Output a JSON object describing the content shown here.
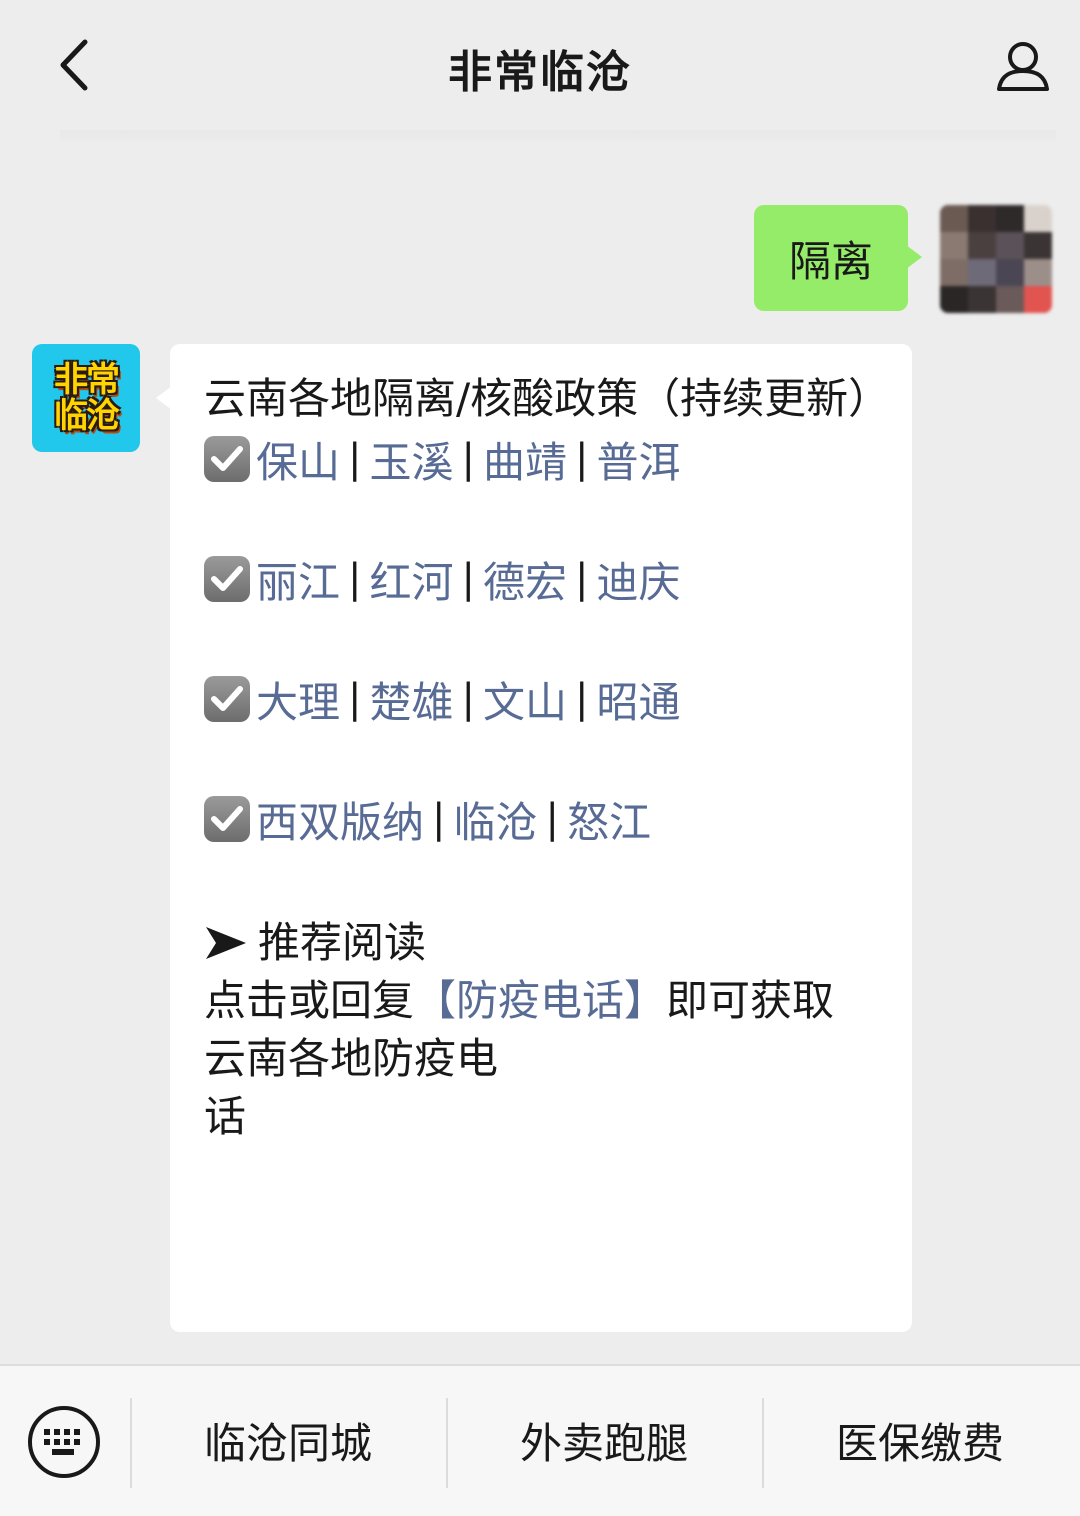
{
  "header": {
    "title": "非常临沧"
  },
  "outgoing": {
    "text": "隔离"
  },
  "bot": {
    "avatar_line1": "非常",
    "avatar_line2": "临沧"
  },
  "message": {
    "title": "云南各地隔离/核酸政策（持续更新）",
    "rows": [
      [
        "保山",
        "玉溪",
        "曲靖",
        "普洱"
      ],
      [
        "丽江",
        "红河",
        "德宏",
        "迪庆"
      ],
      [
        "大理",
        "楚雄",
        "文山",
        "昭通"
      ],
      [
        "西双版纳",
        "临沧",
        "怒江"
      ]
    ],
    "separator": "|",
    "recommend_label": "推荐阅读",
    "tip_prefix": "点击或回复",
    "tip_link": "【防疫电话】",
    "tip_suffix": "即可获取",
    "tip_line2": "云南各地防疫电",
    "tip_line3": "话"
  },
  "bottom_menu": {
    "items": [
      "临沧同城",
      "外卖跑腿",
      "医保缴费"
    ]
  },
  "colors": {
    "background": "#ededed",
    "outgoing_bubble": "#95ec69",
    "link": "#576b95",
    "bot_avatar": "#22c7ec"
  },
  "icons": {
    "back": "chevron-left-icon",
    "profile": "person-icon",
    "keyboard": "keyboard-icon",
    "check": "checkbox-checked-icon",
    "arrow": "arrow-right-icon"
  }
}
